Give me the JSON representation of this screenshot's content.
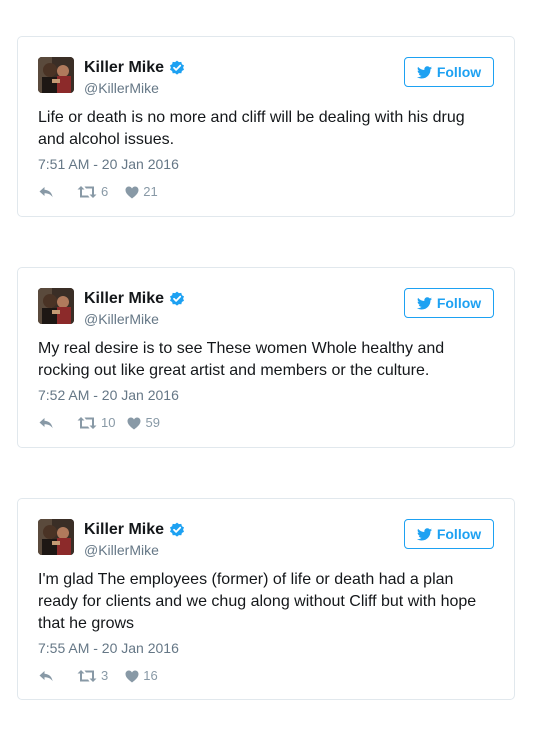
{
  "tweets": [
    {
      "display_name": "Killer Mike",
      "handle": "@KillerMike",
      "follow_label": "Follow",
      "text": "Life or death is no more and cliff will be dealing with his drug and alcohol issues.",
      "timestamp": "7:51 AM - 20 Jan 2016",
      "retweets": "6",
      "likes": "21"
    },
    {
      "display_name": "Killer Mike",
      "handle": "@KillerMike",
      "follow_label": "Follow",
      "text": "My real desire is to see These women Whole healthy and rocking out like great artist and members or the culture.",
      "timestamp": "7:52 AM - 20 Jan 2016",
      "retweets": "10",
      "likes": "59"
    },
    {
      "display_name": "Killer Mike",
      "handle": "@KillerMike",
      "follow_label": "Follow",
      "text": "I'm glad The employees (former) of life or death had a plan ready for clients and we chug along without Cliff but with hope that he grows",
      "timestamp": "7:55 AM - 20 Jan 2016",
      "retweets": "3",
      "likes": "16"
    }
  ],
  "colors": {
    "accent": "#1da1f2",
    "verified": "#1da1f2",
    "muted": "#657786",
    "icon": "#8899a6",
    "border": "#e1e8ed"
  },
  "icons": {
    "verified": "verified-badge-icon",
    "follow": "twitter-bird-icon",
    "reply": "reply-icon",
    "retweet": "retweet-icon",
    "like": "heart-icon"
  }
}
